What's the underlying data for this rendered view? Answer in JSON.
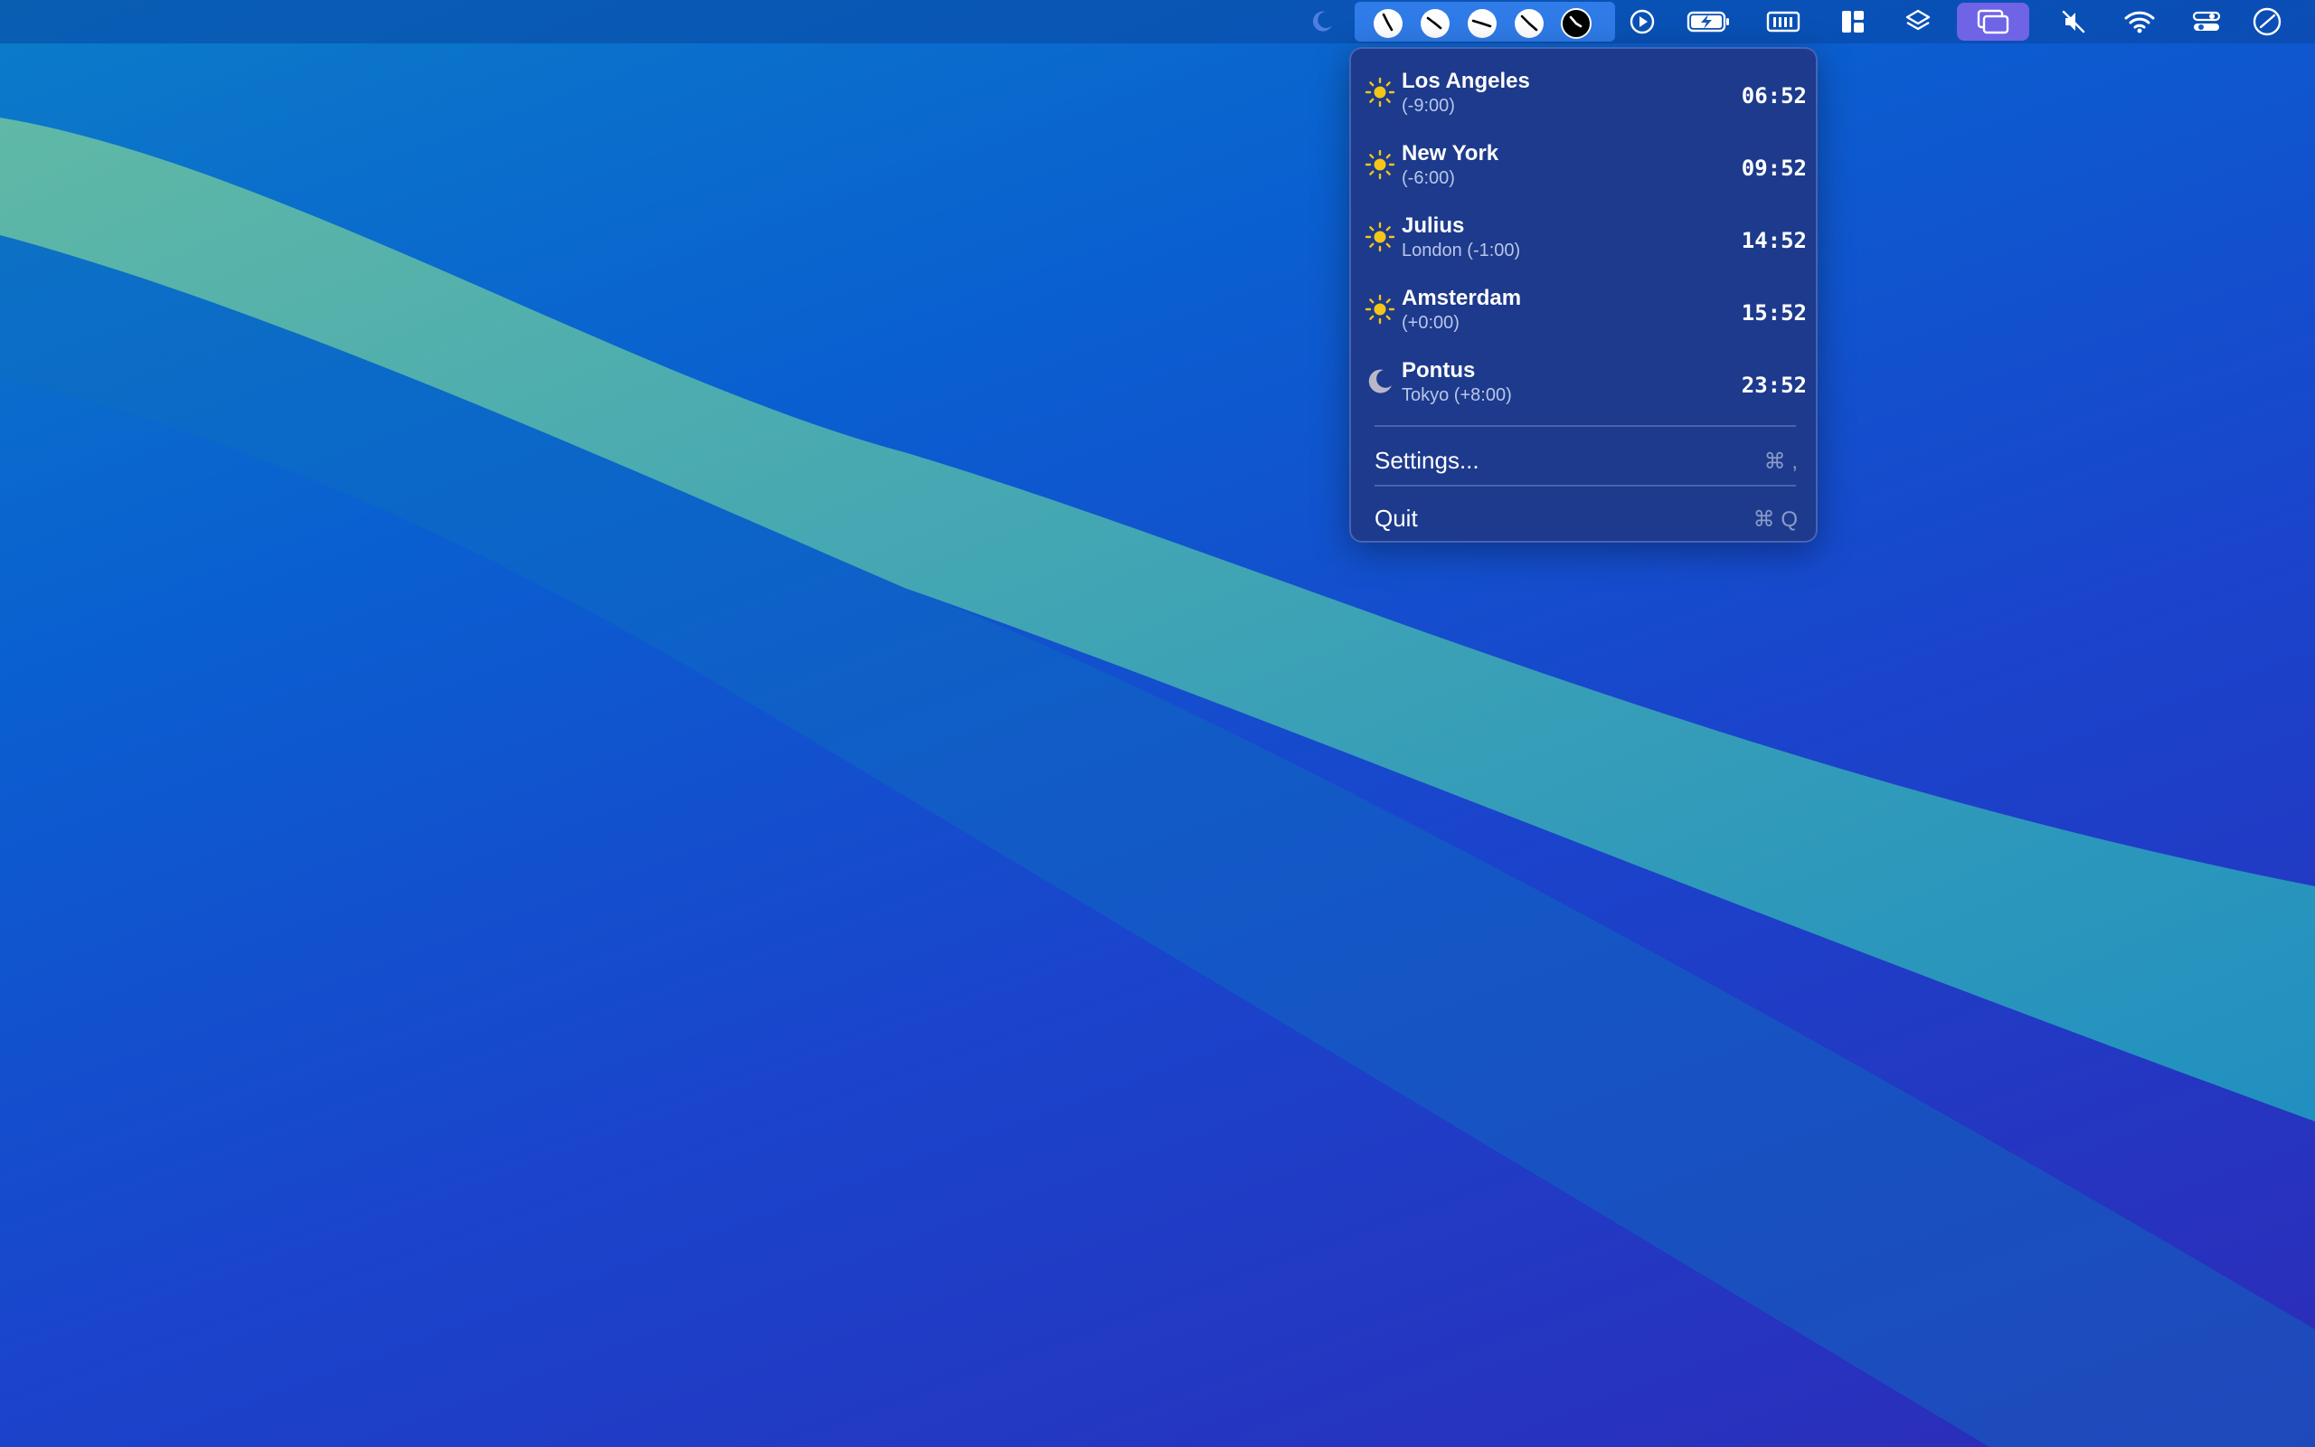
{
  "menubar": {
    "icons": [
      "moon-icon",
      "clock-icon",
      "clock-icon",
      "clock-icon",
      "clock-icon",
      "clock-icon",
      "play-circle-icon",
      "battery-charging-icon",
      "memory-icon",
      "layout-icon",
      "layers-icon",
      "window-stack-icon",
      "mute-icon",
      "wifi-icon",
      "control-center-icon",
      "dial-clock-icon"
    ]
  },
  "timezones": [
    {
      "name": "Los Angeles",
      "subtitle": "(-9:00)",
      "time": "06:52",
      "icon": "sun-icon"
    },
    {
      "name": "New York",
      "subtitle": "(-6:00)",
      "time": "09:52",
      "icon": "sun-icon"
    },
    {
      "name": "Julius",
      "subtitle": "London (-1:00)",
      "time": "14:52",
      "icon": "sun-icon"
    },
    {
      "name": "Amsterdam",
      "subtitle": "(+0:00)",
      "time": "15:52",
      "icon": "sun-icon"
    },
    {
      "name": "Pontus",
      "subtitle": "Tokyo (+8:00)",
      "time": "23:52",
      "icon": "moon-icon"
    }
  ],
  "menu": {
    "settings_label": "Settings...",
    "settings_shortcut": "⌘ ,",
    "quit_label": "Quit",
    "quit_shortcut": "⌘ Q"
  },
  "colors": {
    "sun": "#f5c518",
    "moon": "#b8b8c8",
    "dropdown_bg": "#1d3a8c",
    "clock_group_bg": "#2f7be8",
    "active_app_bg": "#6f63e6"
  }
}
